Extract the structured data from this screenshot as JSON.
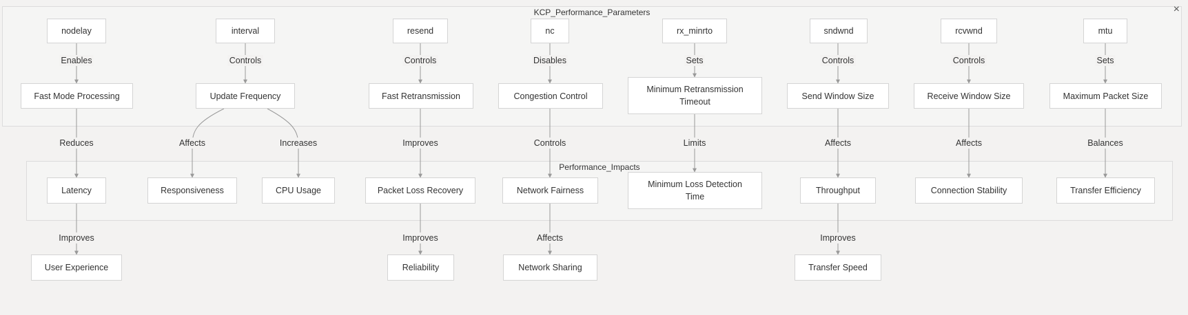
{
  "clusters": {
    "params": {
      "title": "KCP_Performance_Parameters"
    },
    "impacts": {
      "title": "Performance_Impacts"
    }
  },
  "close_icon": "×",
  "nodes": {
    "nodelay": "nodelay",
    "interval": "interval",
    "resend": "resend",
    "nc": "nc",
    "rx_minrto": "rx_minrto",
    "sndwnd": "sndwnd",
    "rcvwnd": "rcvwnd",
    "mtu": "mtu",
    "fast_mode": "Fast Mode Processing",
    "update_freq": "Update Frequency",
    "fast_retrans": "Fast Retransmission",
    "congestion": "Congestion Control",
    "min_retrans": "Minimum Retransmission Timeout",
    "send_window": "Send Window Size",
    "recv_window": "Receive Window Size",
    "max_packet": "Maximum Packet Size",
    "latency": "Latency",
    "responsiveness": "Responsiveness",
    "cpu_usage": "CPU Usage",
    "packet_loss": "Packet Loss Recovery",
    "net_fairness": "Network Fairness",
    "min_loss": "Minimum Loss Detection Time",
    "throughput": "Throughput",
    "conn_stability": "Connection Stability",
    "transfer_eff": "Transfer Efficiency",
    "user_exp": "User Experience",
    "reliability": "Reliability",
    "net_sharing": "Network Sharing",
    "transfer_speed": "Transfer Speed"
  },
  "edges": {
    "e1": "Enables",
    "e2": "Controls",
    "e3": "Controls",
    "e4": "Disables",
    "e5": "Sets",
    "e6": "Controls",
    "e7": "Controls",
    "e8": "Sets",
    "e9": "Reduces",
    "e10": "Affects",
    "e11": "Increases",
    "e12": "Improves",
    "e13": "Controls",
    "e14": "Limits",
    "e15": "Affects",
    "e16": "Affects",
    "e17": "Balances",
    "e18": "Improves",
    "e19": "Improves",
    "e20": "Affects",
    "e21": "Improves"
  }
}
